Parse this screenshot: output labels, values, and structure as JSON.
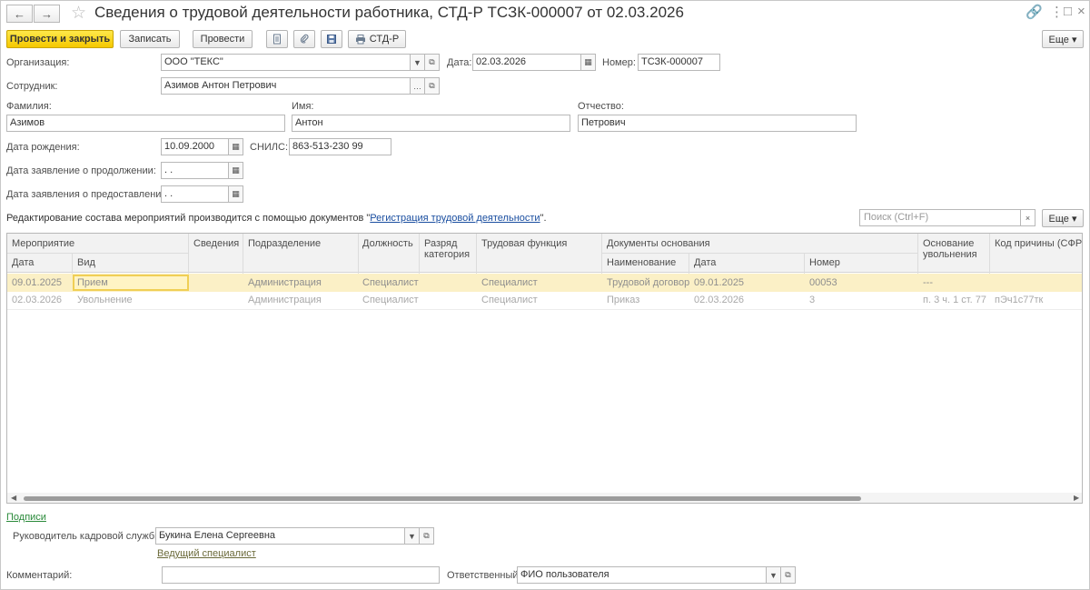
{
  "window": {
    "title": "Сведения о трудовой деятельности работника, СТД-Р ТСЗК-000007 от 02.03.2026"
  },
  "nav": {
    "back_glyph": "←",
    "forward_glyph": "→",
    "star_glyph": "☆"
  },
  "titlebar_icons": {
    "link": "🔗",
    "menu": "⋮",
    "maximize": "□",
    "close": "×"
  },
  "toolbar": {
    "post_close": "Провести и закрыть",
    "save": "Записать",
    "post": "Провести",
    "stdr": "СТД-Р",
    "more": "Еще ▾"
  },
  "form": {
    "org_label": "Организация:",
    "org_value": "ООО \"ТЕКС\"",
    "date_label": "Дата:",
    "date_value": "02.03.2026",
    "number_label": "Номер:",
    "number_value": "ТСЗК-000007",
    "employee_label": "Сотрудник:",
    "employee_value": "Азимов Антон Петрович",
    "surname_label": "Фамилия:",
    "surname_value": "Азимов",
    "name_label": "Имя:",
    "name_value": "Антон",
    "patronymic_label": "Отчество:",
    "patronymic_value": "Петрович",
    "birth_label": "Дата рождения:",
    "birth_value": "10.09.2000",
    "snils_label": "СНИЛС:",
    "snils_value": "863-513-230 99",
    "continue_label": "Дата заявление о продолжении:",
    "continue_value": " .  .",
    "provide_label": "Дата заявления о предоставлении:",
    "provide_value": " .  .",
    "info_prefix": "Редактирование состава мероприятий производится с помощью документов \"",
    "info_link": "Регистрация трудовой деятельности",
    "info_suffix": "\".",
    "search_placeholder": "Поиск (Ctrl+F)",
    "more": "Еще ▾"
  },
  "table": {
    "headers": {
      "event": "Мероприятие",
      "date": "Дата",
      "kind": "Вид",
      "info": "Сведения",
      "division": "Подразделение",
      "position": "Должность",
      "grade": "Разряд категория",
      "function": "Трудовая функция",
      "docs": "Документы основания",
      "doc_name": "Наименование",
      "doc_date": "Дата",
      "doc_number": "Номер",
      "dismissal": "Основание увольнения",
      "reason_code": "Код причины (СФР)"
    },
    "rows": [
      {
        "date": "09.01.2025",
        "kind": "Прием",
        "info": "",
        "division": "Администрация",
        "position": "Специалист",
        "grade": "",
        "function": "Специалист",
        "doc_name": "Трудовой договор",
        "doc_date": "09.01.2025",
        "doc_number": "00053",
        "dismissal": "---",
        "reason_code": ""
      },
      {
        "date": "02.03.2026",
        "kind": "Увольнение",
        "info": "",
        "division": "Администрация",
        "position": "Специалист",
        "grade": "",
        "function": "Специалист",
        "doc_name": "Приказ",
        "doc_date": "02.03.2026",
        "doc_number": "3",
        "dismissal": "п. 3 ч. 1 ст. 77",
        "reason_code": "пЭч1с77тк"
      }
    ]
  },
  "footer": {
    "signatures_link": "Подписи",
    "hr_head_label": "Руководитель кадровой службы:",
    "hr_head_value": "Букина Елена Сергеевна",
    "hr_head_position": "Ведущий специалист",
    "comment_label": "Комментарий:",
    "comment_value": "",
    "responsible_label": "Ответственный:",
    "responsible_value": "ФИО пользователя"
  },
  "colors": {
    "primary_button": "#f5c800",
    "selected_row": "#fbf0c6",
    "link": "#1a4ea0"
  }
}
